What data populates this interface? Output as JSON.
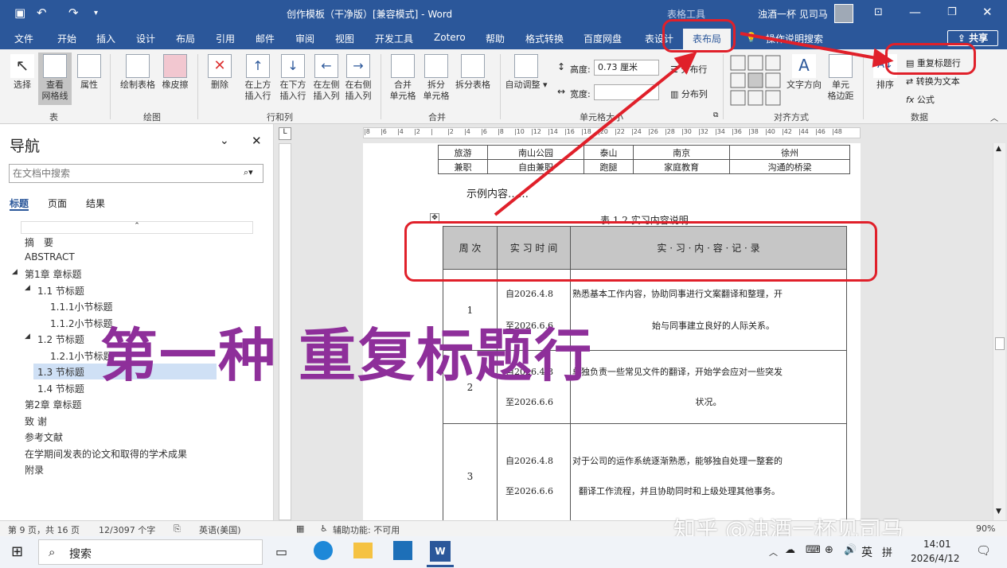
{
  "app": {
    "window_title": "创作模板（干净版）[兼容模式] - Word",
    "contextual_title": "表格工具",
    "user": "浊酒一杯 见司马"
  },
  "tabs": [
    "文件",
    "开始",
    "插入",
    "设计",
    "布局",
    "引用",
    "邮件",
    "审阅",
    "视图",
    "开发工具",
    "Zotero",
    "帮助",
    "格式转换",
    "百度网盘",
    "表设计",
    "表布局"
  ],
  "tell_me": "操作说明搜索",
  "share": "共享",
  "ribbon": {
    "select": "选择",
    "gridlines": "查看\n网格线",
    "properties": "属性",
    "draw_table": "绘制表格",
    "eraser": "橡皮擦",
    "delete": "删除",
    "insert_above": "在上方\n插入行",
    "insert_below": "在下方\n插入行",
    "insert_left": "在左侧\n插入列",
    "insert_right": "在右侧\n插入列",
    "merge_cells": "合并\n单元格",
    "split_cells": "拆分\n单元格",
    "split_table": "拆分表格",
    "autofit": "自动调整",
    "height_label": "高度:",
    "height_value": "0.73 厘米",
    "width_label": "宽度:",
    "distribute_rows": "分布行",
    "distribute_cols": "分布列",
    "text_direction": "文字方向",
    "cell_margins": "单元\n格边距",
    "sort": "排序",
    "repeat_header": "重复标题行",
    "convert_text": "转换为文本",
    "formula": "公式",
    "groups": [
      "表",
      "绘图",
      "行和列",
      "合并",
      "单元格大小",
      "对齐方式",
      "数据"
    ]
  },
  "nav": {
    "title": "导航",
    "search_placeholder": "在文档中搜索",
    "tabs": [
      "标题",
      "页面",
      "结果"
    ],
    "items": [
      "摘　要",
      "ABSTRACT",
      "第1章 章标题",
      "1.1 节标题",
      "1.1.1小节标题",
      "1.1.2小节标题",
      "1.2 节标题",
      "1.2.1小节标题",
      "1.3 节标题",
      "1.4 节标题",
      "第2章 章标题",
      "致 谢",
      "参考文献",
      "在学期间发表的论文和取得的学术成果",
      "附录"
    ]
  },
  "ruler_marks": [
    "8",
    "6",
    "4",
    "2",
    "",
    "2",
    "4",
    "6",
    "8",
    "10",
    "12",
    "14",
    "16",
    "18",
    "20",
    "22",
    "24",
    "26",
    "28",
    "30",
    "32",
    "34",
    "36",
    "38",
    "40",
    "42",
    "44",
    "46",
    "48"
  ],
  "doc": {
    "top_table": [
      [
        "旅游",
        "南山公园",
        "泰山",
        "南京",
        "徐州"
      ],
      [
        "兼职",
        "自由兼职",
        "跑腿",
        "家庭教育",
        "沟通的桥梁"
      ]
    ],
    "example_text": "示例内容……",
    "caption": "表 1.2 实习内容说明",
    "headers": [
      "周 次",
      "实 习 时 间",
      "实 · 习 · 内 · 容 · 记 · 录"
    ],
    "rows": [
      {
        "week": "1",
        "date_from": "自2026.4.8",
        "date_to": "至2026.6.6",
        "content": [
          "熟悉基本工作内容，协助同事进行文案翻译和整理，开",
          "始与同事建立良好的人际关系。"
        ]
      },
      {
        "week": "2",
        "date_from": "自2026.4.8",
        "date_to": "至2026.6.6",
        "content": [
          "单独负责一些常见文件的翻译，开始学会应对一些突发",
          "状况。"
        ]
      },
      {
        "week": "3",
        "date_from": "自2026.4.8",
        "date_to": "至2026.6.6",
        "content": [
          "对于公司的运作系统逐渐熟悉，能够独自处理一整套的",
          "翻译工作流程，并且协助同时和上级处理其他事务。"
        ]
      }
    ]
  },
  "overlay_text": "第一种 重复标题行",
  "watermark": "知乎 @浊酒一杯见司马",
  "status": {
    "page": "第 9 页，共 16 页",
    "words": "12/3097 个字",
    "lang": "英语(美国)",
    "accessibility": "辅助功能: 不可用",
    "zoom": "90%"
  },
  "taskbar": {
    "search": "搜索",
    "ime": "英",
    "time": "14:01",
    "date": "2026/4/12"
  },
  "colors": {
    "brand": "#2b579a",
    "annotation": "#e0202a",
    "overlay": "#8e2f9a",
    "nav_selected": "#cfe0f5"
  }
}
